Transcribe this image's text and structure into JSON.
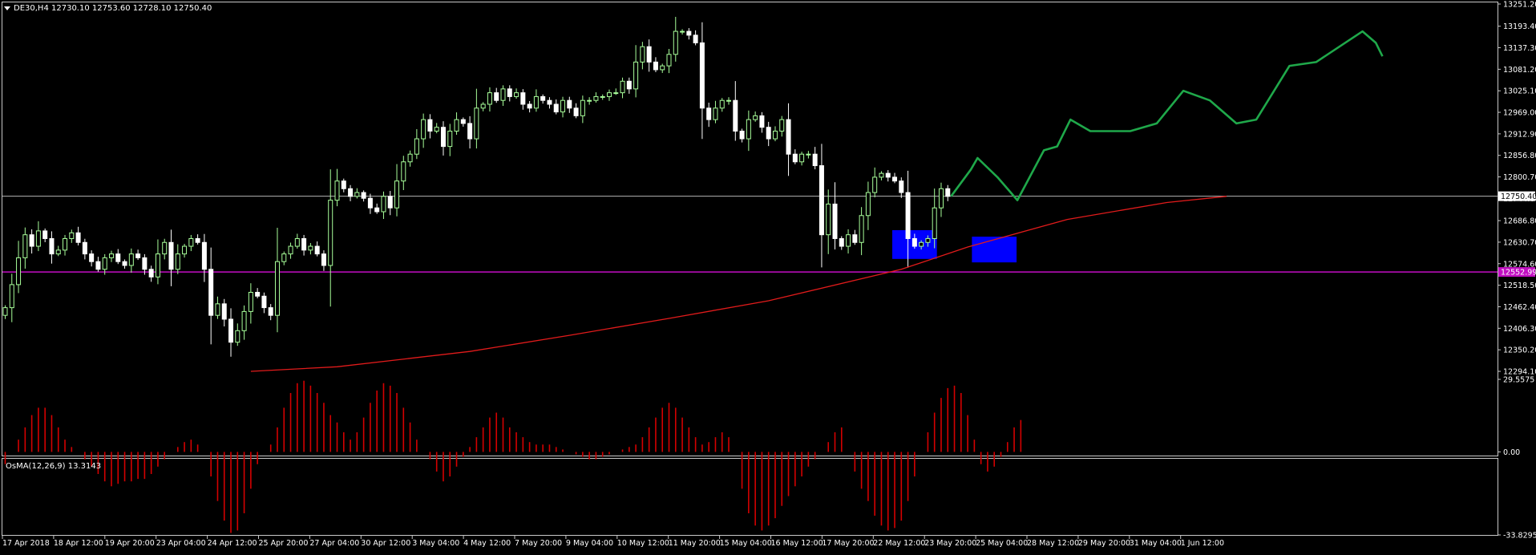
{
  "window": {
    "symbol_label": "DE30,H4",
    "ohlc": "12730.10 12753.60 12728.10 12750.40",
    "menu_icon": "triangle-down-icon"
  },
  "colors": {
    "background": "#000000",
    "frame": "#c8c8c8",
    "bull": "#a8ff9a",
    "bear": "#ffffff",
    "ma": "#e11b1b",
    "hline_price": "#b4b4b4",
    "hline_magenta": "#c20ec2",
    "zone": "#0000ff",
    "forecast": "#1fa84a",
    "osma": "#d40000"
  },
  "price_panel": {
    "y_ticks": [
      "13251.20",
      "13193.40",
      "13137.30",
      "13081.20",
      "13025.10",
      "12969.00",
      "12912.90",
      "12856.80",
      "12800.70",
      "12744.60",
      "12686.80",
      "12630.70",
      "12574.60",
      "12518.50",
      "12462.40",
      "12406.30",
      "12350.20",
      "12294.10"
    ],
    "ylim": [
      12294.1,
      13251.2
    ],
    "current_price": 12750.4,
    "current_price_label": "12750.40",
    "level_price": 12552.99,
    "level_label": "12552.99"
  },
  "osma_panel": {
    "label": "OsMA(12,26,9) 13.3143",
    "ticks": [
      "29.5575",
      "0.00",
      "-33.8295"
    ],
    "ylim": [
      -33.8295,
      29.5575
    ]
  },
  "x_axis": {
    "labels": [
      "17 Apr 2018",
      "18 Apr 12:00",
      "19 Apr 20:00",
      "23 Apr 04:00",
      "24 Apr 12:00",
      "25 Apr 20:00",
      "27 Apr 04:00",
      "30 Apr 12:00",
      "3 May 04:00",
      "4 May 12:00",
      "7 May 20:00",
      "9 May 04:00",
      "10 May 12:00",
      "11 May 20:00",
      "15 May 04:00",
      "16 May 12:00",
      "17 May 20:00",
      "22 May 12:00",
      "23 May 20:00",
      "25 May 04:00",
      "28 May 12:00",
      "29 May 20:00",
      "31 May 04:00",
      "1 Jun 12:00"
    ]
  },
  "chart_data": {
    "type": "candlestick",
    "symbol": "DE30",
    "timeframe": "H4",
    "close": [
      12460,
      12520,
      12590,
      12650,
      12620,
      12660,
      12640,
      12600,
      12610,
      12640,
      12655,
      12630,
      12600,
      12580,
      12560,
      12590,
      12600,
      12580,
      12570,
      12600,
      12590,
      12560,
      12540,
      12600,
      12630,
      12560,
      12600,
      12620,
      12640,
      12630,
      12560,
      12440,
      12470,
      12430,
      12370,
      12400,
      12450,
      12500,
      12490,
      12460,
      12440,
      12580,
      12600,
      12620,
      12640,
      12610,
      12620,
      12600,
      12570,
      12740,
      12790,
      12770,
      12750,
      12760,
      12745,
      12720,
      12710,
      12750,
      12720,
      12790,
      12840,
      12860,
      12900,
      12950,
      12920,
      12930,
      12880,
      12920,
      12950,
      12940,
      12900,
      12980,
      12990,
      13020,
      13000,
      13030,
      13010,
      13020,
      12990,
      12980,
      13010,
      13000,
      12990,
      12970,
      13000,
      12980,
      12960,
      13000,
      13000,
      13010,
      13010,
      13020,
      13020,
      13050,
      13030,
      13100,
      13140,
      13100,
      13080,
      13090,
      13120,
      13180,
      13180,
      13170,
      13150,
      12980,
      12950,
      12980,
      13000,
      13000,
      12920,
      12900,
      12950,
      12960,
      12930,
      12900,
      12920,
      12950,
      12860,
      12840,
      12860,
      12860,
      12830,
      12650,
      12730,
      12640,
      12620,
      12650,
      12630,
      12700,
      12760,
      12800,
      12810,
      12800,
      12790,
      12760,
      12640,
      12620,
      12630,
      12640,
      12720,
      12770,
      12750
    ],
    "ma": {
      "period": 200,
      "values": [
        [
          37,
          12294
        ],
        [
          50,
          12306
        ],
        [
          70,
          12346
        ],
        [
          85,
          12388
        ],
        [
          100,
          12432
        ],
        [
          115,
          12478
        ],
        [
          135,
          12560
        ],
        [
          145,
          12618
        ],
        [
          160,
          12690
        ],
        [
          175,
          12734
        ],
        [
          184,
          12750
        ]
      ]
    },
    "levels": [
      12750.4,
      12552.99
    ],
    "zones": [
      {
        "from_bar": 134,
        "to_bar": 140,
        "high": 12662,
        "low": 12587
      },
      {
        "from_bar": 146,
        "to_bar": 152,
        "high": 12645,
        "low": 12578
      }
    ],
    "forecast": [
      [
        0,
        12750
      ],
      [
        3,
        12820
      ],
      [
        4,
        12850
      ],
      [
        7,
        12800
      ],
      [
        10,
        12740
      ],
      [
        14,
        12870
      ],
      [
        16,
        12880
      ],
      [
        18,
        12950
      ],
      [
        21,
        12920
      ],
      [
        27,
        12920
      ],
      [
        31,
        12940
      ],
      [
        35,
        13025
      ],
      [
        39,
        13000
      ],
      [
        43,
        12940
      ],
      [
        46,
        12950
      ],
      [
        51,
        13090
      ],
      [
        55,
        13100
      ],
      [
        62,
        13180
      ],
      [
        64,
        13150
      ],
      [
        65,
        13115
      ]
    ],
    "osma": [
      -5,
      0,
      5,
      10,
      15,
      18,
      18,
      15,
      10,
      5,
      2,
      0,
      -3,
      -6,
      -9,
      -12,
      -14,
      -13,
      -12,
      -12,
      -11,
      -11,
      -9,
      -6,
      -3,
      0,
      2,
      4,
      5,
      3,
      0,
      -10,
      -20,
      -28,
      -33,
      -32,
      -25,
      -15,
      -5,
      0,
      3,
      10,
      18,
      24,
      28,
      29,
      27,
      24,
      20,
      15,
      12,
      8,
      5,
      8,
      14,
      20,
      25,
      28,
      27,
      24,
      18,
      12,
      5,
      0,
      -3,
      -8,
      -12,
      -10,
      -6,
      -2,
      2,
      6,
      10,
      14,
      16,
      14,
      10,
      8,
      6,
      4,
      3,
      3,
      3,
      2,
      1,
      0,
      -1,
      -2,
      -3,
      -3,
      -2,
      -1,
      0,
      1,
      2,
      3,
      6,
      10,
      14,
      18,
      20,
      18,
      14,
      10,
      6,
      3,
      4,
      6,
      8,
      6,
      0,
      -15,
      -25,
      -30,
      -32,
      -30,
      -27,
      -22,
      -18,
      -14,
      -10,
      -6,
      -3,
      0,
      4,
      8,
      10,
      0,
      -8,
      -15,
      -20,
      -26,
      -30,
      -32,
      -31,
      -28,
      -20,
      -10,
      0,
      8,
      16,
      22,
      26,
      27,
      24,
      15,
      5,
      -5,
      -8,
      -6,
      -2,
      4,
      10,
      13
    ]
  }
}
